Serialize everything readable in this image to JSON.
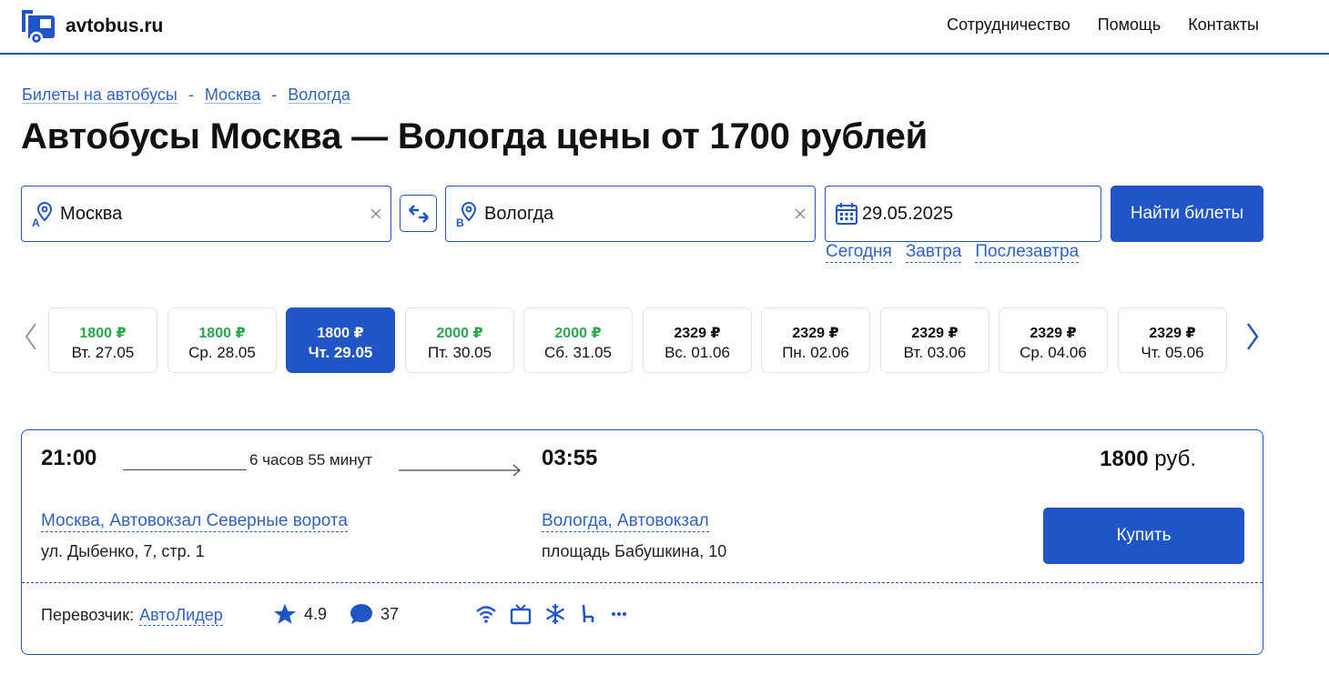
{
  "header": {
    "logo_text": "avtobus.ru",
    "nav": [
      "Сотрудничество",
      "Помощь",
      "Контакты"
    ]
  },
  "breadcrumb": {
    "items": [
      "Билеты на автобусы",
      "Москва",
      "Вологда"
    ],
    "separator": "-"
  },
  "page_title": "Автобусы Москва — Вологда цены от 1700 рублей",
  "search": {
    "from_value": "Москва",
    "to_value": "Вологда",
    "date_value": "29.05.2025",
    "submit_label": "Найти билеты",
    "quick_dates": [
      "Сегодня",
      "Завтра",
      "Послезавтра"
    ]
  },
  "dates": [
    {
      "price": "1800 ₽",
      "day": "Вт. 27.05",
      "state": "green"
    },
    {
      "price": "1800 ₽",
      "day": "Ср. 28.05",
      "state": "green"
    },
    {
      "price": "1800 ₽",
      "day": "Чт. 29.05",
      "state": "active"
    },
    {
      "price": "2000 ₽",
      "day": "Пт. 30.05",
      "state": "green"
    },
    {
      "price": "2000 ₽",
      "day": "Сб. 31.05",
      "state": "green"
    },
    {
      "price": "2329 ₽",
      "day": "Вс. 01.06",
      "state": "plain"
    },
    {
      "price": "2329 ₽",
      "day": "Пн. 02.06",
      "state": "plain"
    },
    {
      "price": "2329 ₽",
      "day": "Вт. 03.06",
      "state": "plain"
    },
    {
      "price": "2329 ₽",
      "day": "Ср. 04.06",
      "state": "plain"
    },
    {
      "price": "2329 ₽",
      "day": "Чт. 05.06",
      "state": "plain"
    }
  ],
  "trip": {
    "departure_time": "21:00",
    "duration": "6 часов 55 минут",
    "arrival_time": "03:55",
    "price_amount": "1800",
    "price_currency": "руб.",
    "from_station": "Москва, Автовокзал Северные ворота",
    "from_address": "ул. Дыбенко, 7, стр. 1",
    "to_station": "Вологда, Автовокзал",
    "to_address": "площадь Бабушкина, 10",
    "buy_label": "Купить",
    "carrier_label": "Перевозчик:",
    "carrier_name": "АвтоЛидер",
    "rating": "4.9",
    "reviews": "37",
    "amenities": [
      "wifi-icon",
      "tv-icon",
      "air-conditioning-icon",
      "seat-icon",
      "more-icon"
    ]
  },
  "colors": {
    "brand_blue": "#1f55c6",
    "link_blue": "#2f62c2",
    "price_green": "#2aa84a"
  }
}
